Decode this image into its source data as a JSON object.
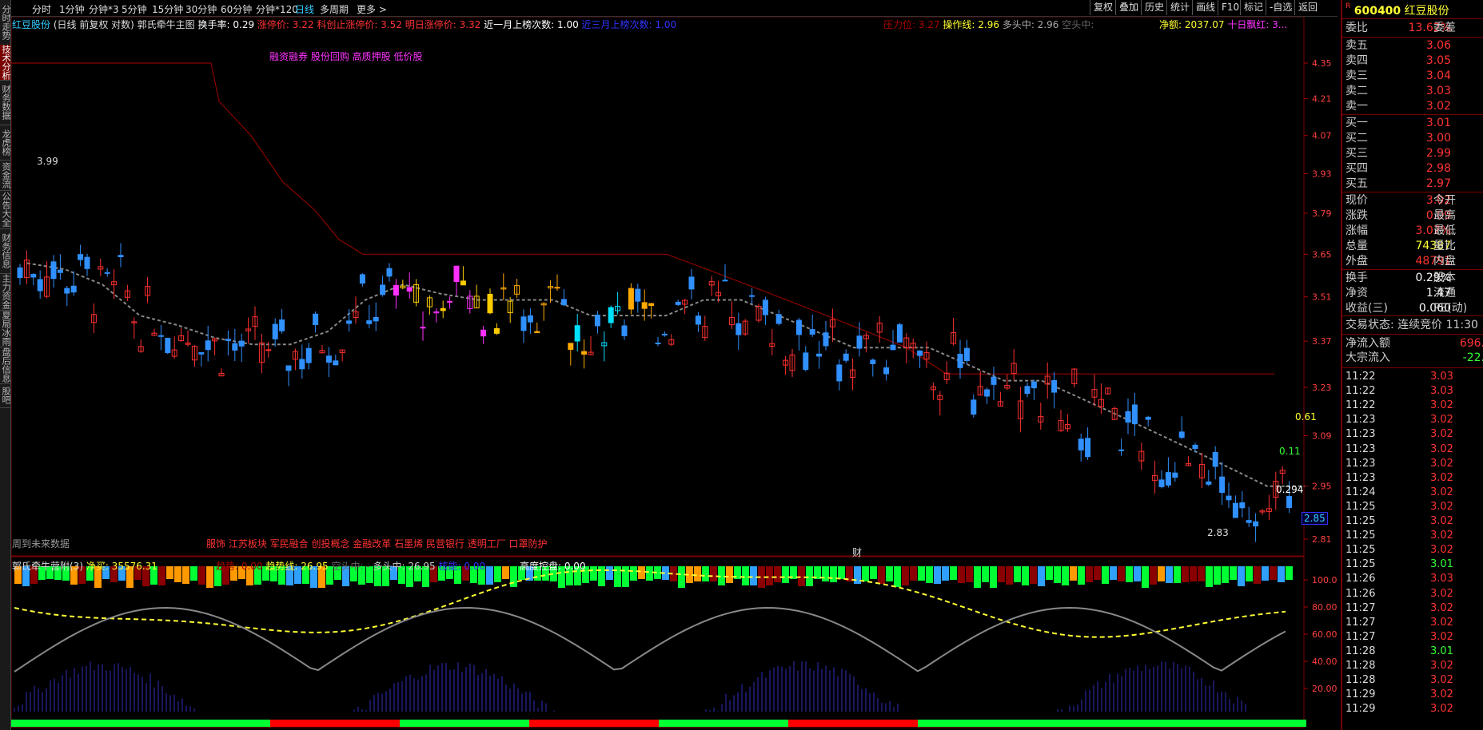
{
  "left_tabs": [
    "分时走势",
    "技术分析",
    "财务数据",
    "龙虎榜",
    "资金流",
    "公告大全",
    "财务信息",
    "主力资金",
    "夏局冰雨",
    "盘后信息",
    "股吧"
  ],
  "toolbar": {
    "periods": [
      "分时",
      "1分钟",
      "分钟*3",
      "5分钟",
      "15分钟",
      "30分钟",
      "60分钟",
      "分钟*120",
      "日线",
      "多周期",
      "更多 >"
    ],
    "selected": "日线",
    "right_buttons": [
      "复权",
      "叠加",
      "历史",
      "统计",
      "画线",
      "F10",
      "标记",
      "-自选",
      "返回"
    ]
  },
  "main_header": {
    "stock_name": "红豆股份",
    "adjust": "(日线 前复权 对数)",
    "indicator_name": "郭氏牵牛主图",
    "turnover_label": "换手率: 0.29",
    "limit_up": "涨停价: 3.22",
    "star_limit": "科创止涨停价: 3.52",
    "tomorrow_limit": "明日涨停价: 3.32",
    "month_board": "近一月上榜次数: 1.00",
    "three_month": "近三月上榜次数: 1.00",
    "pressure": "压力位: 3.27",
    "op_line": "操作线: 2.96",
    "long_mid": "多头中: 2.96",
    "short_mid": "空头中:",
    "net_amount": "净额: 2037.07",
    "ten_day_red": "十日飘红: 3..."
  },
  "concept_tags_top": "融资融券 股份回购 高质押股 低价股",
  "concept_tags_bottom": "服饰 江苏板块 军民融合 创投概念 金融改革 石墨烯 民营银行 透明工厂 口罩防护",
  "no_future_data": "周到未来数据",
  "price_annotations": {
    "high": "3.99",
    "low": "2.83",
    "cai": "财"
  },
  "right_axis_main": [
    "4.35",
    "4.21",
    "4.07",
    "3.93",
    "3.79",
    "3.65",
    "3.51",
    "3.37",
    "3.23",
    "3.09",
    "2.95",
    "2.81"
  ],
  "current_price_marker": "2.85",
  "side_values": {
    "v1": "0.61",
    "v2": "0.11",
    "v3": "0.294"
  },
  "sub_header": {
    "name": "郭氏牵牛营附(3)",
    "net_buy": "净买: 35576.31",
    "momentum": "趋势: 0.00",
    "trend_line": "趋势线: 26.95",
    "short_mid": "空头中: -",
    "long_mid": "多头中: 26.95",
    "core": "核能: 0.00",
    "control": "高度控盘: 0.00"
  },
  "right_axis_sub": [
    "100.0",
    "80.00",
    "60.00",
    "40.00",
    "20.00"
  ],
  "quote": {
    "code": "600400",
    "name": "红豆股份",
    "wei_bi_label": "委比",
    "wei_bi": "13.62%",
    "wei_cha_label": "委差",
    "asks": [
      {
        "label": "卖五",
        "price": "3.06"
      },
      {
        "label": "卖四",
        "price": "3.05"
      },
      {
        "label": "卖三",
        "price": "3.04"
      },
      {
        "label": "卖二",
        "price": "3.03"
      },
      {
        "label": "卖一",
        "price": "3.02"
      }
    ],
    "bids": [
      {
        "label": "买一",
        "price": "3.01"
      },
      {
        "label": "买二",
        "price": "3.00"
      },
      {
        "label": "买三",
        "price": "2.99"
      },
      {
        "label": "买四",
        "price": "2.98"
      },
      {
        "label": "买五",
        "price": "2.97"
      }
    ],
    "stats": [
      {
        "label": "现价",
        "value": "3.02",
        "label2": "今开",
        "color": "#ff3333"
      },
      {
        "label": "涨跌",
        "value": "0.09",
        "label2": "最高",
        "color": "#ff3333"
      },
      {
        "label": "涨幅",
        "value": "3.07%",
        "label2": "最低",
        "color": "#ff3333"
      },
      {
        "label": "总量",
        "value": "74387",
        "label2": "量比",
        "color": "#ffff33"
      },
      {
        "label": "外盘",
        "value": "48791",
        "label2": "内盘",
        "color": "#ff3333"
      }
    ],
    "stats2": [
      {
        "label": "换手",
        "value": "0.29%",
        "label2": "股本"
      },
      {
        "label": "净资",
        "value": "1.47",
        "label2": "流通"
      },
      {
        "label": "收益(三)",
        "value": "0.060",
        "label2": "PE(动)"
      }
    ],
    "trade_status": "交易状态: 连续竞价 11:30",
    "net_inflow_label": "净流入额",
    "net_inflow": "696.",
    "block_label": "大宗流入",
    "block": "-22.",
    "ticks": [
      [
        "11:22",
        "3.03"
      ],
      [
        "11:22",
        "3.03"
      ],
      [
        "11:22",
        "3.02"
      ],
      [
        "11:23",
        "3.02"
      ],
      [
        "11:23",
        "3.02"
      ],
      [
        "11:23",
        "3.02"
      ],
      [
        "11:23",
        "3.02"
      ],
      [
        "11:23",
        "3.02"
      ],
      [
        "11:24",
        "3.02"
      ],
      [
        "11:25",
        "3.02"
      ],
      [
        "11:25",
        "3.02"
      ],
      [
        "11:25",
        "3.02"
      ],
      [
        "11:25",
        "3.02"
      ],
      [
        "11:25",
        "3.01"
      ],
      [
        "11:26",
        "3.03"
      ],
      [
        "11:26",
        "3.02"
      ],
      [
        "11:27",
        "3.02"
      ],
      [
        "11:27",
        "3.02"
      ],
      [
        "11:27",
        "3.02"
      ],
      [
        "11:28",
        "3.01"
      ],
      [
        "11:28",
        "3.02"
      ],
      [
        "11:28",
        "3.02"
      ],
      [
        "11:29",
        "3.02"
      ],
      [
        "11:29",
        "3.02"
      ]
    ]
  },
  "chart_data": {
    "type": "candlestick",
    "y_range": [
      2.81,
      4.35
    ],
    "y_scale": "log",
    "trend_cross_y": [
      3.62,
      3.6,
      3.55,
      3.45,
      3.42,
      3.38,
      3.36,
      3.36,
      3.4,
      3.5,
      3.55,
      3.52,
      3.5,
      3.5,
      3.5,
      3.45,
      3.45,
      3.45,
      3.5,
      3.5,
      3.45,
      3.4,
      3.35,
      3.35,
      3.35,
      3.3,
      3.25,
      3.25,
      3.2,
      3.15,
      3.1,
      3.05,
      3.0,
      2.95,
      2.95
    ],
    "band_upper_y": [
      4.35,
      4.35,
      4.35,
      4.35,
      4.35,
      4.2,
      4.07,
      3.9,
      3.8,
      3.7,
      3.65,
      3.65,
      3.65,
      3.65,
      3.65,
      3.65,
      3.65,
      3.65,
      3.65,
      3.6,
      3.55,
      3.5,
      3.45,
      3.4,
      3.35,
      3.27,
      3.27,
      3.27,
      3.27,
      3.27
    ]
  }
}
